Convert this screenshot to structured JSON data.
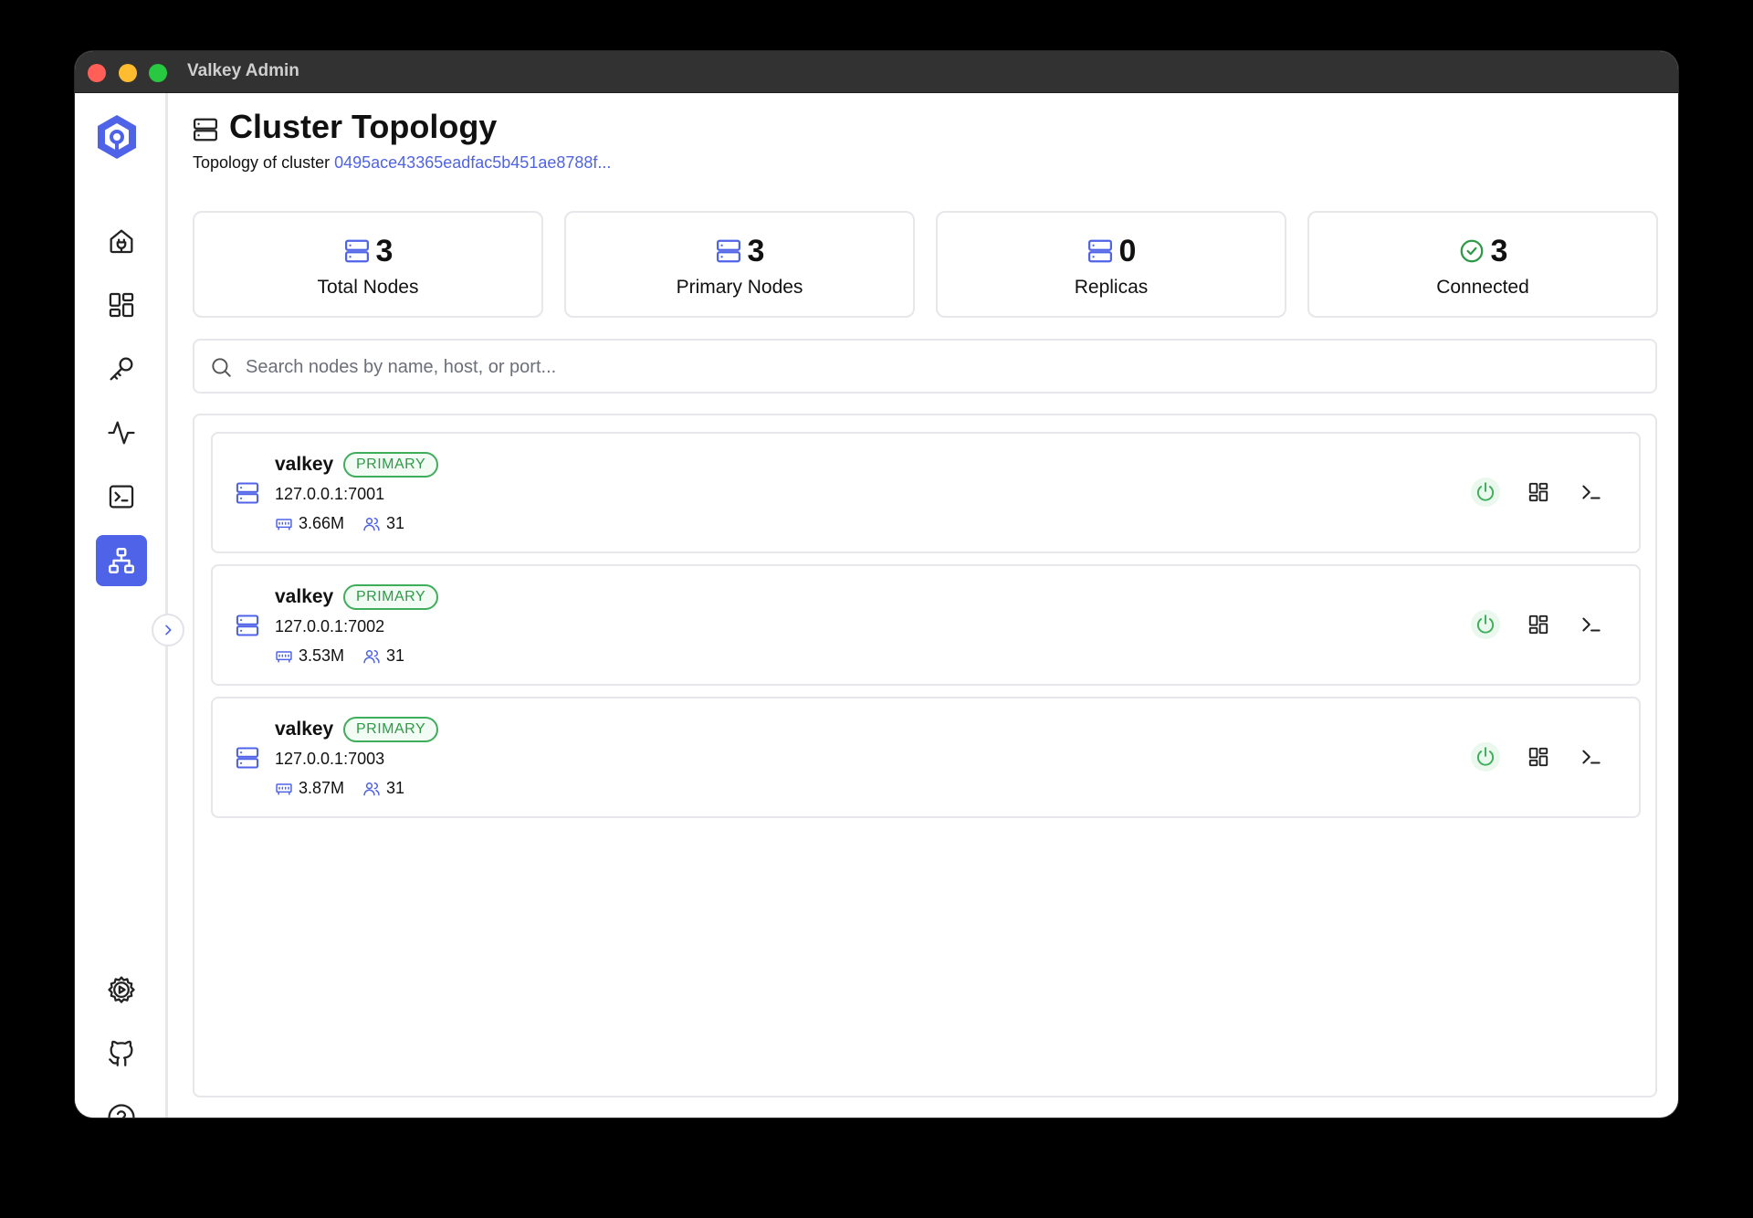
{
  "window": {
    "title": "Valkey Admin"
  },
  "sidebar": {
    "items": [
      {
        "icon": "home-plug-icon",
        "name": "connections"
      },
      {
        "icon": "dashboard-icon",
        "name": "dashboard"
      },
      {
        "icon": "key-icon",
        "name": "key-browser"
      },
      {
        "icon": "activity-icon",
        "name": "monitoring"
      },
      {
        "icon": "terminal-icon",
        "name": "command-console"
      },
      {
        "icon": "network-icon",
        "name": "cluster-topology",
        "active": true
      }
    ],
    "bottom_items": [
      {
        "icon": "settings-gear-icon",
        "name": "settings"
      },
      {
        "icon": "github-icon",
        "name": "github"
      },
      {
        "icon": "help-icon",
        "name": "help"
      }
    ]
  },
  "header": {
    "title": "Cluster Topology",
    "subtitle_prefix": "Topology of cluster",
    "cluster_id": "0495ace43365eadfac5b451ae8788f..."
  },
  "stats": [
    {
      "value": "3",
      "label": "Total Nodes",
      "icon": "server-icon"
    },
    {
      "value": "3",
      "label": "Primary Nodes",
      "icon": "server-icon"
    },
    {
      "value": "0",
      "label": "Replicas",
      "icon": "server-icon"
    },
    {
      "value": "3",
      "label": "Connected",
      "icon": "check-circle-icon"
    }
  ],
  "search": {
    "placeholder": "Search nodes by name, host, or port...",
    "value": ""
  },
  "nodes": [
    {
      "name": "valkey",
      "role": "PRIMARY",
      "address": "127.0.0.1:7001",
      "memory": "3.66M",
      "clients": "31"
    },
    {
      "name": "valkey",
      "role": "PRIMARY",
      "address": "127.0.0.1:7002",
      "memory": "3.53M",
      "clients": "31"
    },
    {
      "name": "valkey",
      "role": "PRIMARY",
      "address": "127.0.0.1:7003",
      "memory": "3.87M",
      "clients": "31"
    }
  ],
  "colors": {
    "accent": "#4f63e8",
    "success": "#2e9a48",
    "border": "#e6e7eb"
  }
}
